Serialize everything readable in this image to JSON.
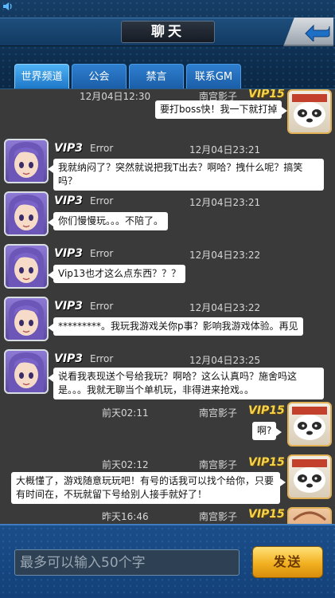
{
  "header": {
    "title": "聊天",
    "tabs": [
      {
        "label": "世界频道",
        "active": true
      },
      {
        "label": "公会",
        "active": false
      },
      {
        "label": "禁言",
        "active": false
      },
      {
        "label": "联系GM",
        "active": false
      }
    ],
    "back_icon": "back-arrow-icon",
    "status_icon": "volume-icon"
  },
  "messages": [
    {
      "side": "right",
      "vip": "VIP15",
      "name": "南宫影子",
      "time": "12月04日12:30",
      "text": "要打boss快！我一下就打掉"
    },
    {
      "side": "left",
      "vip": "VIP3",
      "name": "Error",
      "time": "12月04日23:21",
      "text": "我就纳闷了？突然就说把我T出去？啊哈？拽什么呢？搞笑吗？"
    },
    {
      "side": "left",
      "vip": "VIP3",
      "name": "Error",
      "time": "12月04日23:21",
      "text": "你们慢慢玩。。。不陪了。"
    },
    {
      "side": "left",
      "vip": "VIP3",
      "name": "Error",
      "time": "12月04日23:22",
      "text": "Vip13也才这么点东西？？？"
    },
    {
      "side": "left",
      "vip": "VIP3",
      "name": "Error",
      "time": "12月04日23:22",
      "text": "*********。我玩我游戏关你p事？影响我游戏体验。再见"
    },
    {
      "side": "left",
      "vip": "VIP3",
      "name": "Error",
      "time": "12月04日23:25",
      "text": "说看我表现送个号给我玩？啊哈？这么认真吗？施舍吗这是。。。我就无聊当个单机玩，非得进来抢戏。。"
    },
    {
      "side": "right",
      "vip": "VIP15",
      "name": "南宫影子",
      "time": "前天02:11",
      "text": "啊?"
    },
    {
      "side": "right",
      "vip": "VIP15",
      "name": "南宫影子",
      "time": "前天02:12",
      "text": "大概懂了，游戏随意玩玩吧！有号的话我可以找个给你，只要有时间在，不玩就留下号给别人接手就好了！"
    },
    {
      "side": "right",
      "vip": "VIP15",
      "name": "南宫影子",
      "time": "昨天16:46",
      "text": ""
    }
  ],
  "input": {
    "placeholder": "最多可以输入50个字",
    "value": "",
    "send_label": "发送"
  },
  "colors": {
    "header_blue": "#123a62",
    "tab_blue": "#1b5ea8",
    "chat_bg": "#3a3a3a",
    "send_gold": "#f2b020",
    "vip15_gold": "#f7d34a"
  }
}
